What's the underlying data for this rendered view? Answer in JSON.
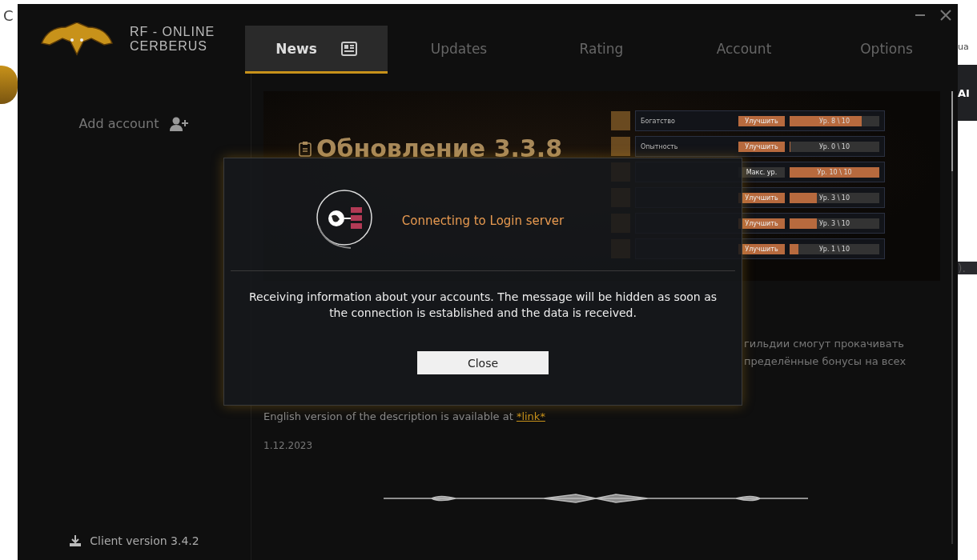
{
  "background_window": {
    "left_fragment": "C",
    "right_fragments": [
      "ua",
      "AI",
      ")."
    ]
  },
  "app": {
    "logo_line_1": "RF - ONLINE",
    "logo_line_2": "CERBERUS"
  },
  "tabs": [
    {
      "label": "News",
      "selected": true
    },
    {
      "label": "Updates",
      "selected": false
    },
    {
      "label": "Rating",
      "selected": false
    },
    {
      "label": "Account",
      "selected": false
    },
    {
      "label": "Options",
      "selected": false
    }
  ],
  "sidebar": {
    "add_account": "Add account",
    "client_version": "Client version 3.4.2"
  },
  "banner": {
    "title": "Обновление 3.3.8",
    "skills": [
      {
        "name": "Богатство",
        "kind": "upgrade",
        "button": "Улучшить",
        "level": 0.8,
        "reading": "Ур. 8 \\ 10"
      },
      {
        "name": "Опытность",
        "kind": "upgrade",
        "button": "Улучшить",
        "level": 0,
        "reading": "Ур. 0 \\ 10"
      },
      {
        "kind": "max",
        "button": "Макс. ур.",
        "level": 1,
        "reading": "Ур. 10 \\ 10"
      },
      {
        "kind": "upgrade",
        "button": "Улучшить",
        "level": 0.3,
        "reading": "Ур. 3 \\ 10"
      },
      {
        "kind": "upgrade",
        "button": "Улучшить",
        "level": 0.3,
        "reading": "Ур. 3 \\ 10"
      },
      {
        "kind": "upgrade",
        "button": "Улучшить",
        "level": 0.1,
        "reading": "Ур. 1 \\ 10"
      }
    ]
  },
  "article": {
    "visible_line_tails": [
      "гильдии смогут прокачивать",
      "пределённые бонусы на всех"
    ],
    "english_note": "English version of the description is available at",
    "link": "*link*",
    "date": "1.12.2023"
  },
  "dialog": {
    "title": "Connecting to Login server",
    "message": "Receiving information about your accounts. The message will be hidden as soon as the connection is established and the data is received.",
    "button": "Close"
  }
}
